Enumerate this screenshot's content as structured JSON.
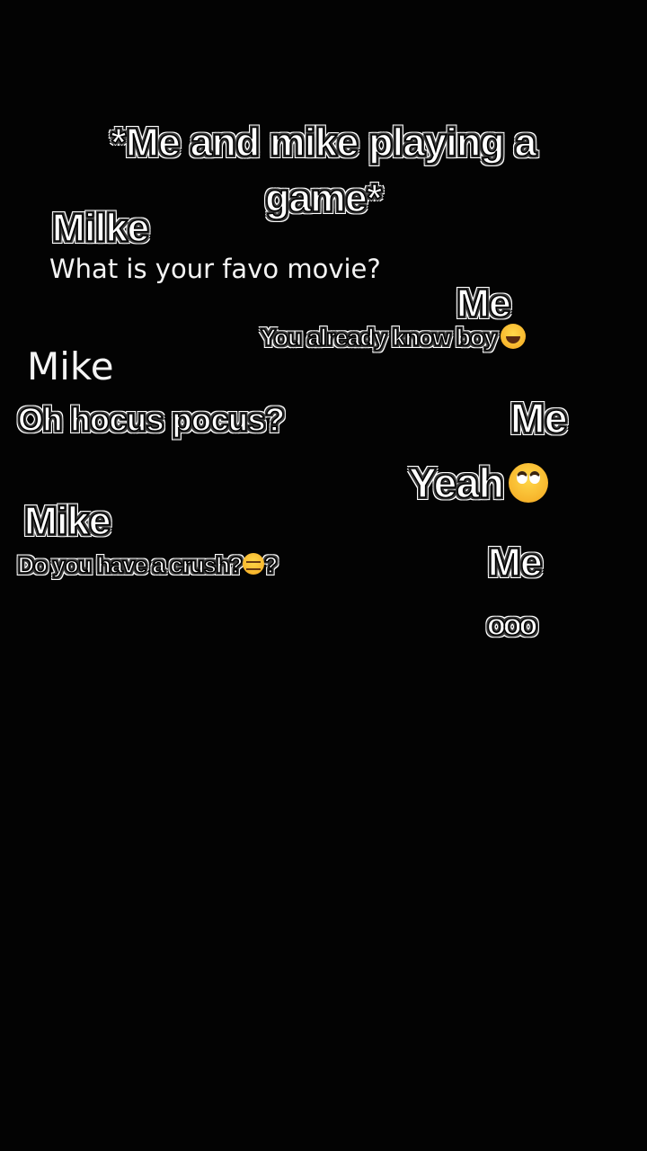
{
  "title": "*Me and mike playing a game*",
  "messages": [
    {
      "speaker": "Milke",
      "text": "What is your favo movie?"
    },
    {
      "speaker": "Me",
      "text": "You already know boy",
      "emoji": "face-with-tears-of-joy-emoji"
    },
    {
      "speaker": "Mike",
      "text": "Oh hocus pocus?"
    },
    {
      "speaker": "Me",
      "text": "Yeah",
      "emoji": "face-with-rolling-eyes-emoji"
    },
    {
      "speaker": "Mike",
      "text": "Do you have a crush?",
      "emoji": "expressionless-face-emoji",
      "suffix": "?"
    },
    {
      "speaker": "Me",
      "text": "ooo"
    }
  ]
}
